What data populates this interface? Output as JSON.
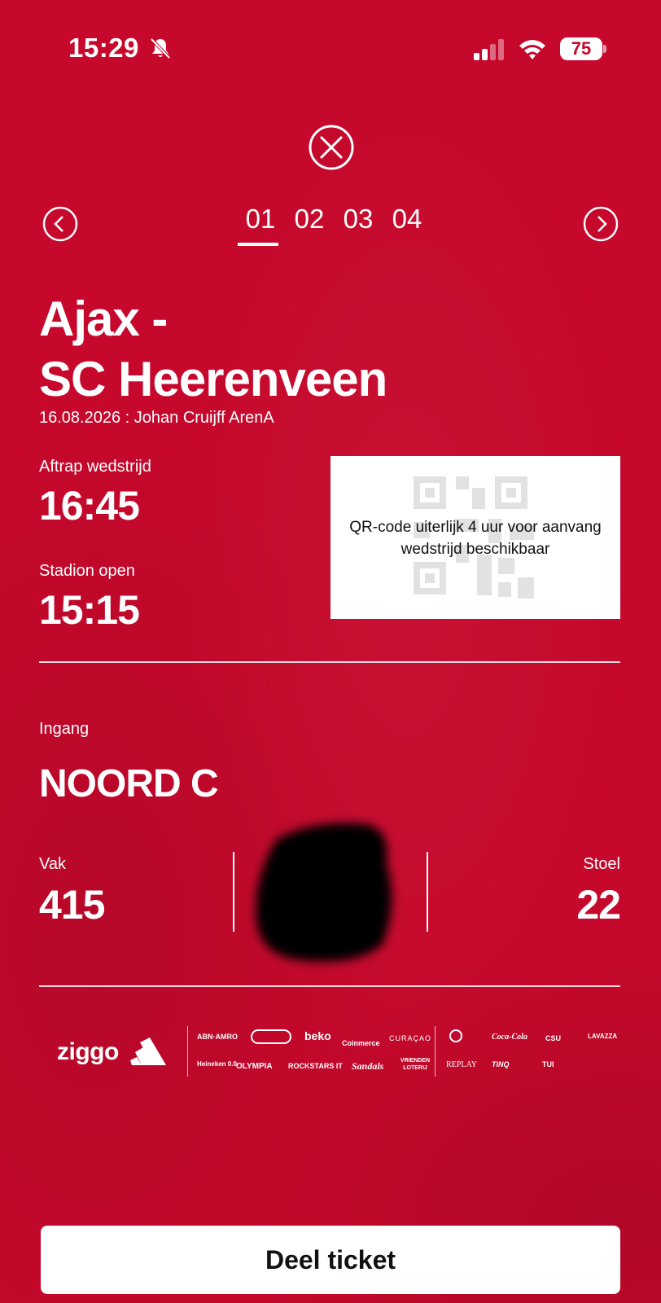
{
  "status_bar": {
    "time": "15:29",
    "battery": "75",
    "icons": [
      "bell-slash-icon",
      "signal-icon",
      "wifi-icon",
      "battery-icon"
    ]
  },
  "header": {
    "close_icon": "close-circle-x-icon",
    "tabs": [
      {
        "label": "01",
        "active": true
      },
      {
        "label": "02",
        "active": false
      },
      {
        "label": "03",
        "active": false
      },
      {
        "label": "04",
        "active": false
      }
    ]
  },
  "ticket": {
    "match_line1": "Ajax -",
    "match_line2": "SC Heerenveen",
    "date_venue": "16.08.2026 : Johan Cruijff ArenA",
    "kickoff_label": "Aftrap wedstrijd",
    "kickoff_time": "16:45",
    "stadium_open_label": "Stadion open",
    "stadium_open_time": "15:15",
    "qr_notice": "QR-code uiterlijk 4 uur voor aanvang wedstrijd beschikbaar",
    "entrance_label": "Ingang",
    "entrance_value": "NOORD C",
    "section_label": "Vak",
    "section_value": "415",
    "seat_label": "Stoel",
    "seat_value": "22"
  },
  "sponsors": {
    "primary": [
      "ziggo",
      "adidas"
    ],
    "row1": [
      "ABN·AMRO",
      "beko",
      "Coinmerce",
      "CURAÇAO"
    ],
    "row2": [
      "Heineken 0.0",
      "OLYMPIA",
      "ROCKSTARS IT",
      "Sandals",
      "VRIENDEN LOTERIJ"
    ],
    "row3": [
      "Coca-Cola",
      "CSU",
      "LAVAZZA"
    ],
    "row4": [
      "REPLAY",
      "TINQ",
      "TUI"
    ]
  },
  "actions": {
    "share_label": "Deel ticket"
  },
  "colors": {
    "background": "#c5082c",
    "accent": "#ffffff"
  }
}
